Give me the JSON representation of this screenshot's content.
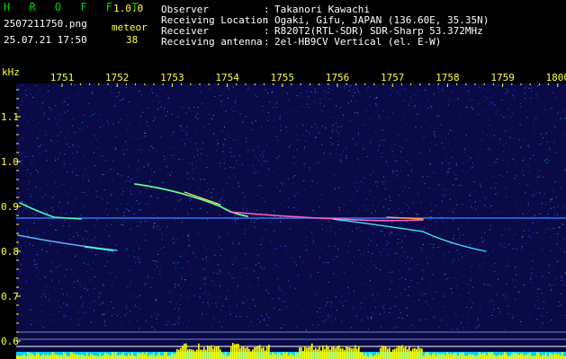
{
  "header": {
    "app_name": "H R O F F T",
    "app_version": "1.0.0",
    "filename": "2507211750.png",
    "datetime": "25.07.21 17:50",
    "meteor_label": "meteor",
    "meteor_count": "38"
  },
  "info": [
    {
      "label": "Observer",
      "value": "Takanori Kawachi"
    },
    {
      "label": "Receiving Location",
      "value": "Ogaki, Gifu, JAPAN (136.60E, 35.35N)"
    },
    {
      "label": "Receiver",
      "value": "R820T2(RTL-SDR) SDR-Sharp 53.372MHz"
    },
    {
      "label": "Receiving antenna",
      "value": "2el-HB9CV Vertical (el. E-W)"
    }
  ],
  "axes": {
    "y_unit": "kHz",
    "y_ticks": [
      "1.1",
      "1.0",
      "0.9",
      "0.8",
      "0.7",
      "0.6"
    ],
    "x_ticks": [
      "1751",
      "1752",
      "1753",
      "1754",
      "1755",
      "1756",
      "1757",
      "1758",
      "1759",
      "1800"
    ]
  },
  "colors": {
    "background": "#000000",
    "spectrogram_bg": "#0a0a46",
    "axis_text": "#ffff40",
    "app_title": "#00d200",
    "level_bars": "#ffff00",
    "level_base": "#00d0ff"
  }
}
